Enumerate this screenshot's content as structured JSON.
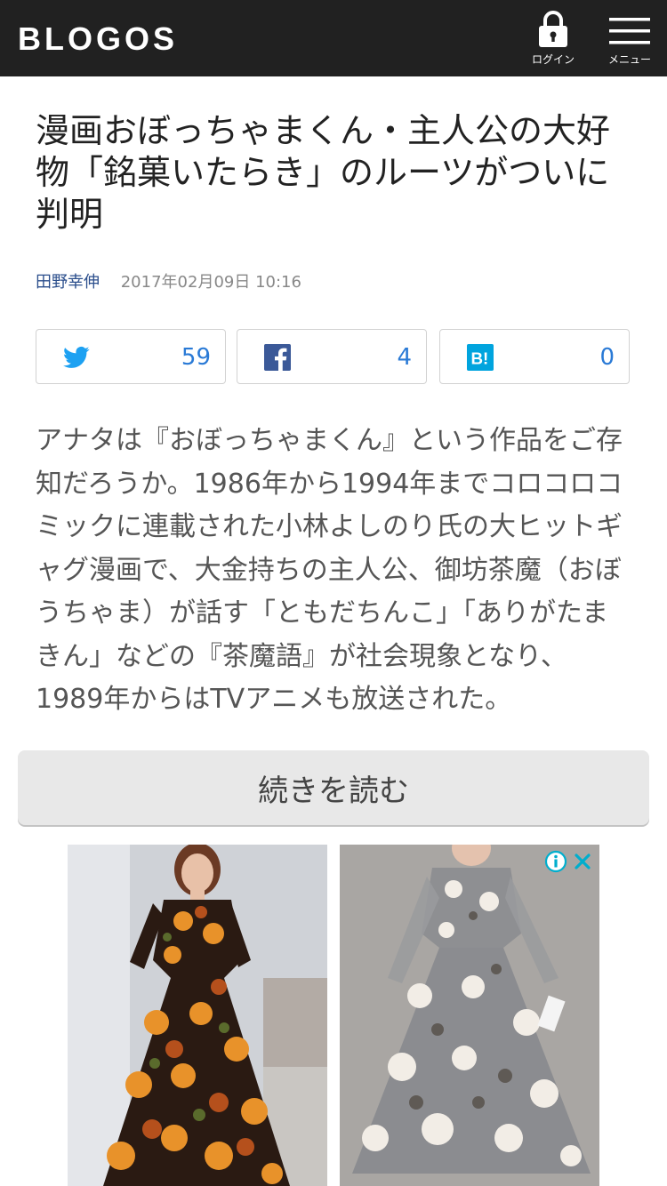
{
  "header": {
    "logo": "BLOGOS",
    "login_label": "ログイン",
    "menu_label": "メニュー"
  },
  "article": {
    "title": "漫画おぼっちゃまくん・主人公の大好物「銘菓いたらき」のルーツがついに判明",
    "author": "田野幸伸",
    "date": "2017年02月09日 10:16",
    "body": "アナタは『おぼっちゃまくん』という作品をご存知だろうか。1986年から1994年までコロコロコミックに連載された小林よしのり氏の大ヒットギャグ漫画で、大金持ちの主人公、御坊茶魔（おぼうちゃま）が話す「ともだちんこ」「ありがたまきん」などの『茶魔語』が社会現象となり、1989年からはTVアニメも放送された。"
  },
  "share": {
    "twitter": {
      "icon": "twitter-icon",
      "count": "59",
      "color": "#1da1f2"
    },
    "facebook": {
      "icon": "facebook-icon",
      "count": "4",
      "color": "#3b5998"
    },
    "hatena": {
      "icon": "hatena-bookmark-icon",
      "count": "0",
      "color": "#00a4de"
    }
  },
  "read_more_label": "続きを読む",
  "ad": {
    "items": [
      {
        "name": "floral-maxi-dress-image"
      },
      {
        "name": "gray-floral-lace-dress-image"
      }
    ],
    "info_icon": "info-icon",
    "close_icon": "close-icon"
  },
  "colors": {
    "header_bg": "#212121",
    "link": "#2b4e8c",
    "count": "#2a7ad6",
    "button_bg": "#e8e8e8"
  }
}
